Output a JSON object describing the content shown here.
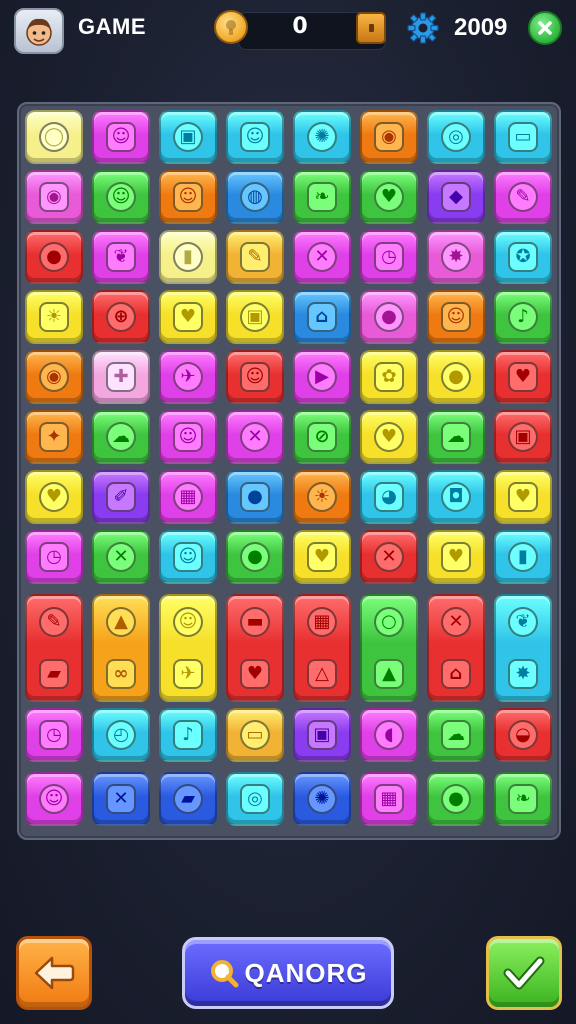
{
  "header": {
    "title": "GAME",
    "coins": "0",
    "score": "2009"
  },
  "footer": {
    "main_button_label": "QANORG"
  },
  "board": {
    "rows": [
      [
        {
          "color": "#f6f08a",
          "icon": "speech-bubble-icon",
          "glyph": "◯"
        },
        {
          "color": "#e040e8",
          "icon": "face-icon",
          "glyph": "☺"
        },
        {
          "color": "#2fc4e8",
          "icon": "door-icon",
          "glyph": "▣"
        },
        {
          "color": "#2fc4e8",
          "icon": "cat-face-icon",
          "glyph": "☺"
        },
        {
          "color": "#2fc4e8",
          "icon": "gear-icon",
          "glyph": "✺"
        },
        {
          "color": "#f07a12",
          "icon": "eyes-icon",
          "glyph": "◉"
        },
        {
          "color": "#2fc4e8",
          "icon": "snail-icon",
          "glyph": "◎"
        },
        {
          "color": "#2fc4e8",
          "icon": "battery-icon",
          "glyph": "▭"
        }
      ],
      [
        {
          "color": "#e85ad8",
          "icon": "eye-icon",
          "glyph": "◉"
        },
        {
          "color": "#3fc43f",
          "icon": "smile-icon",
          "glyph": "☺"
        },
        {
          "color": "#f07a12",
          "icon": "smile-icon",
          "glyph": "☺"
        },
        {
          "color": "#2a8ae0",
          "icon": "ball-icon",
          "glyph": "◍"
        },
        {
          "color": "#3fc43f",
          "icon": "leaf-icon",
          "glyph": "❧"
        },
        {
          "color": "#3fc43f",
          "icon": "heart-icon",
          "glyph": "♥"
        },
        {
          "color": "#8a3cf0",
          "icon": "gem-icon",
          "glyph": "◆"
        },
        {
          "color": "#e040e8",
          "icon": "chat-icon",
          "glyph": "✎"
        }
      ],
      [
        {
          "color": "#e83030",
          "icon": "apple-icon",
          "glyph": "●"
        },
        {
          "color": "#e040e8",
          "icon": "bird-icon",
          "glyph": "❦"
        },
        {
          "color": "#f6f08a",
          "icon": "battery-icon",
          "glyph": "▮"
        },
        {
          "color": "#f2b233",
          "icon": "pencil-icon",
          "glyph": "✎"
        },
        {
          "color": "#e040e8",
          "icon": "cross-icon",
          "glyph": "✕"
        },
        {
          "color": "#e040e8",
          "icon": "clock-icon",
          "glyph": "◷"
        },
        {
          "color": "#e85ad8",
          "icon": "star-badge-icon",
          "glyph": "✸"
        },
        {
          "color": "#2fc4e8",
          "icon": "badge-icon",
          "glyph": "✪"
        }
      ],
      [
        {
          "color": "#f6e02a",
          "icon": "sun-face-icon",
          "glyph": "☀"
        },
        {
          "color": "#e83030",
          "icon": "target-icon",
          "glyph": "⊕"
        },
        {
          "color": "#f6e02a",
          "icon": "heart-icon",
          "glyph": "♥"
        },
        {
          "color": "#f6e02a",
          "icon": "robot-icon",
          "glyph": "▣"
        },
        {
          "color": "#2a8ae0",
          "icon": "house-icon",
          "glyph": "⌂"
        },
        {
          "color": "#e85ad8",
          "icon": "apple-icon",
          "glyph": "●"
        },
        {
          "color": "#f07a12",
          "icon": "face-icon",
          "glyph": "☺"
        },
        {
          "color": "#3fc43f",
          "icon": "drumstick-icon",
          "glyph": "♪"
        }
      ],
      [
        {
          "color": "#f07a12",
          "icon": "map-pin-icon",
          "glyph": "◉"
        },
        {
          "color": "#f4a6e0",
          "icon": "plus-icon",
          "glyph": "✚"
        },
        {
          "color": "#e040e8",
          "icon": "rocket-icon",
          "glyph": "✈"
        },
        {
          "color": "#e83030",
          "icon": "monster-face-icon",
          "glyph": "☺"
        },
        {
          "color": "#e040e8",
          "icon": "play-icon",
          "glyph": "▶"
        },
        {
          "color": "#f6e02a",
          "icon": "cookie-icon",
          "glyph": "✿"
        },
        {
          "color": "#f6e02a",
          "icon": "orange-icon",
          "glyph": "●"
        },
        {
          "color": "#e83030",
          "icon": "heart-icon",
          "glyph": "♥"
        }
      ],
      [
        {
          "color": "#f07a12",
          "icon": "compass-icon",
          "glyph": "✦"
        },
        {
          "color": "#3fc43f",
          "icon": "fire-icon",
          "glyph": "☁"
        },
        {
          "color": "#e040e8",
          "icon": "dog-face-icon",
          "glyph": "☺"
        },
        {
          "color": "#e040e8",
          "icon": "cross-icon",
          "glyph": "✕"
        },
        {
          "color": "#3fc43f",
          "icon": "racket-icon",
          "glyph": "⊘"
        },
        {
          "color": "#f6e02a",
          "icon": "heart-icon",
          "glyph": "♥"
        },
        {
          "color": "#3fc43f",
          "icon": "cloud-icon",
          "glyph": "☁"
        },
        {
          "color": "#e83030",
          "icon": "robot-icon",
          "glyph": "▣"
        }
      ],
      [
        {
          "color": "#f6e02a",
          "icon": "heart-icon",
          "glyph": "♥"
        },
        {
          "color": "#8a3cf0",
          "icon": "brush-icon",
          "glyph": "✐"
        },
        {
          "color": "#e040e8",
          "icon": "qr-code-icon",
          "glyph": "▦"
        },
        {
          "color": "#2a8ae0",
          "icon": "orange-icon",
          "glyph": "●"
        },
        {
          "color": "#f07a12",
          "icon": "sun-face-icon",
          "glyph": "☀"
        },
        {
          "color": "#2fc4e8",
          "icon": "chick-icon",
          "glyph": "◕"
        },
        {
          "color": "#2fc4e8",
          "icon": "camera-icon",
          "glyph": "◘"
        },
        {
          "color": "#f6e02a",
          "icon": "heart-icon",
          "glyph": "♥"
        }
      ],
      [
        {
          "color": "#e040e8",
          "icon": "clock-icon",
          "glyph": "◷"
        },
        {
          "color": "#3fc43f",
          "icon": "crossed-tools-icon",
          "glyph": "✕"
        },
        {
          "color": "#2fc4e8",
          "icon": "frog-icon",
          "glyph": "☺"
        },
        {
          "color": "#3fc43f",
          "icon": "orange-icon",
          "glyph": "●"
        },
        {
          "color": "#f6e02a",
          "icon": "heart-icon",
          "glyph": "♥"
        },
        {
          "color": "#e83030",
          "icon": "cross-icon",
          "glyph": "✕"
        },
        {
          "color": "#f6e02a",
          "icon": "heart-icon",
          "glyph": "♥"
        },
        {
          "color": "#2fc4e8",
          "icon": "battery-icon",
          "glyph": "▮"
        }
      ]
    ],
    "tall_row": [
      {
        "color": "#e83030",
        "icons": [
          "speech-bubble-icon",
          "shoe-icon"
        ],
        "glyphs": [
          "✎",
          "▰"
        ]
      },
      {
        "color": "#f6a21a",
        "icons": [
          "cake-icon",
          "pretzel-icon"
        ],
        "glyphs": [
          "▲",
          "∞"
        ]
      },
      {
        "color": "#f6e02a",
        "icons": [
          "ghost-icon",
          "paper-plane-icon"
        ],
        "glyphs": [
          "☺",
          "✈"
        ]
      },
      {
        "color": "#e83030",
        "icons": [
          "bed-icon",
          "apple-icon"
        ],
        "glyphs": [
          "▬",
          "♥"
        ]
      },
      {
        "color": "#e83030",
        "icons": [
          "building-icon",
          "tent-icon"
        ],
        "glyphs": [
          "▦",
          "△"
        ]
      },
      {
        "color": "#3fc43f",
        "icons": [
          "ring-icon",
          "warning-icon"
        ],
        "glyphs": [
          "○",
          "▲"
        ]
      },
      {
        "color": "#e83030",
        "icons": [
          "cross-icon",
          "house-icon"
        ],
        "glyphs": [
          "✕",
          "⌂"
        ]
      },
      {
        "color": "#2fc4e8",
        "icons": [
          "paw-icon",
          "splat-icon"
        ],
        "glyphs": [
          "❦",
          "✸"
        ]
      }
    ],
    "rows_bottom": [
      [
        {
          "color": "#e040e8",
          "icon": "clock-icon",
          "glyph": "◷"
        },
        {
          "color": "#2fc4e8",
          "icon": "compass-icon",
          "glyph": "◴"
        },
        {
          "color": "#2fc4e8",
          "icon": "drumstick-icon",
          "glyph": "♪"
        },
        {
          "color": "#f2b233",
          "icon": "bread-icon",
          "glyph": "▭"
        },
        {
          "color": "#8a3cf0",
          "icon": "toast-icon",
          "glyph": "▣"
        },
        {
          "color": "#e040e8",
          "icon": "spoon-icon",
          "glyph": "◖"
        },
        {
          "color": "#3fc43f",
          "icon": "chat-icon",
          "glyph": "☁"
        },
        {
          "color": "#e83030",
          "icon": "bowl-icon",
          "glyph": "◒"
        }
      ],
      [
        {
          "color": "#e040e8",
          "icon": "smile-icon",
          "glyph": "☺"
        },
        {
          "color": "#2a5ae0",
          "icon": "compass-icon",
          "glyph": "✕"
        },
        {
          "color": "#2a5ae0",
          "icon": "ticket-icon",
          "glyph": "▰"
        },
        {
          "color": "#2fc4e8",
          "icon": "lollipop-icon",
          "glyph": "◎"
        },
        {
          "color": "#2a5ae0",
          "icon": "gear-icon",
          "glyph": "✺"
        },
        {
          "color": "#e040e8",
          "icon": "calculator-icon",
          "glyph": "▦"
        },
        {
          "color": "#3fc43f",
          "icon": "orange-icon",
          "glyph": "●"
        },
        {
          "color": "#3fc43f",
          "icon": "leaf-icon",
          "glyph": "❧"
        }
      ]
    ]
  }
}
